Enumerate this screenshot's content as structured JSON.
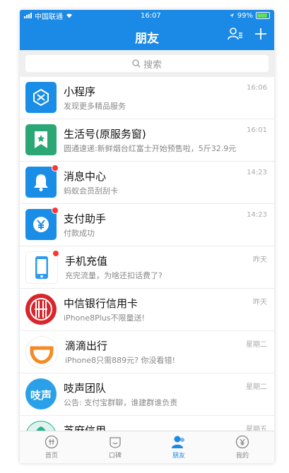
{
  "status": {
    "carrier": "中国联通",
    "time": "16:07",
    "battery": "99%"
  },
  "nav": {
    "title": "朋友"
  },
  "search": {
    "placeholder": "搜索"
  },
  "chats": [
    {
      "name": "小程序",
      "sub": "发现更多精品服务",
      "time": "16:06",
      "unread": false,
      "icon": "mini-program-icon",
      "color": "#1a8ee6"
    },
    {
      "name": "生活号(原服务窗)",
      "sub": "圆通速递:新鲜烟台红富士开始预售啦，5斤32.9元",
      "time": "16:01",
      "unread": false,
      "icon": "life-account-icon",
      "color": "#2aa775"
    },
    {
      "name": "消息中心",
      "sub": "蚂蚁会员刮刮卡",
      "time": "14:23",
      "unread": true,
      "icon": "bell-icon",
      "color": "#1a8ee6"
    },
    {
      "name": "支付助手",
      "sub": "付款成功",
      "time": "14:23",
      "unread": true,
      "icon": "yuan-icon",
      "color": "#1a8ee6"
    },
    {
      "name": "手机充值",
      "sub": "充完流量，为啥还扣话费了?",
      "time": "昨天",
      "unread": true,
      "icon": "phone-icon",
      "color": "#ffffff"
    },
    {
      "name": "中信银行信用卡",
      "sub": "iPhone8Plus不限量送!",
      "time": "昨天",
      "unread": false,
      "icon": "citic-logo-icon",
      "color": "#d7262c"
    },
    {
      "name": "滴滴出行",
      "sub": "iPhone8只需889元? 你没看错!",
      "time": "星期二",
      "unread": false,
      "icon": "didi-logo-icon",
      "color": "#ffffff"
    },
    {
      "name": "吱声团队",
      "sub": "公告: 支付宝群聊，谁建群谁负责",
      "time": "星期二",
      "unread": false,
      "icon": "zhisheng-logo-icon",
      "color": "#2aa0e8",
      "logo_text": "吱声"
    },
    {
      "name": "芝麻信用",
      "sub": "",
      "time": "星期五",
      "unread": false,
      "icon": "sesame-logo-icon",
      "color": "#25b38e"
    }
  ],
  "tabs": [
    {
      "label": "首页",
      "icon": "home-icon",
      "active": false
    },
    {
      "label": "口碑",
      "icon": "koubei-icon",
      "active": false
    },
    {
      "label": "朋友",
      "icon": "friends-icon",
      "active": true
    },
    {
      "label": "我的",
      "icon": "mine-icon",
      "active": false
    }
  ]
}
